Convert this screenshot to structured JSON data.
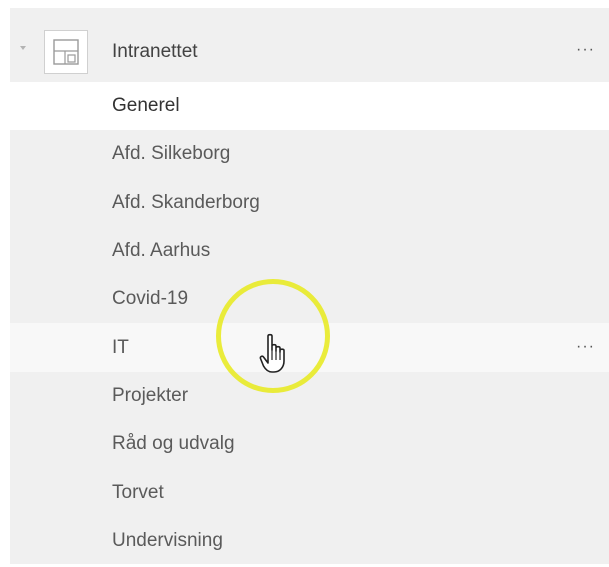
{
  "team": {
    "name": "Intranettet",
    "more_label": "···",
    "icon": "team-tiles-icon",
    "caret_icon": "caret-down-icon"
  },
  "channels": [
    {
      "label": "Generel",
      "state": "active"
    },
    {
      "label": "Afd. Silkeborg",
      "state": ""
    },
    {
      "label": "Afd. Skanderborg",
      "state": ""
    },
    {
      "label": "Afd. Aarhus",
      "state": ""
    },
    {
      "label": "Covid-19",
      "state": ""
    },
    {
      "label": "IT",
      "state": "hovered",
      "more_label": "···"
    },
    {
      "label": "Projekter",
      "state": ""
    },
    {
      "label": "Råd og udvalg",
      "state": ""
    },
    {
      "label": "Torvet",
      "state": ""
    },
    {
      "label": "Undervisning",
      "state": ""
    }
  ],
  "cursor": {
    "icon": "hand-pointer-icon",
    "highlight_color": "#e8ea2a"
  },
  "colors": {
    "panel_bg": "#f0f0f0",
    "active_bg": "#ffffff",
    "text": "#424242"
  }
}
